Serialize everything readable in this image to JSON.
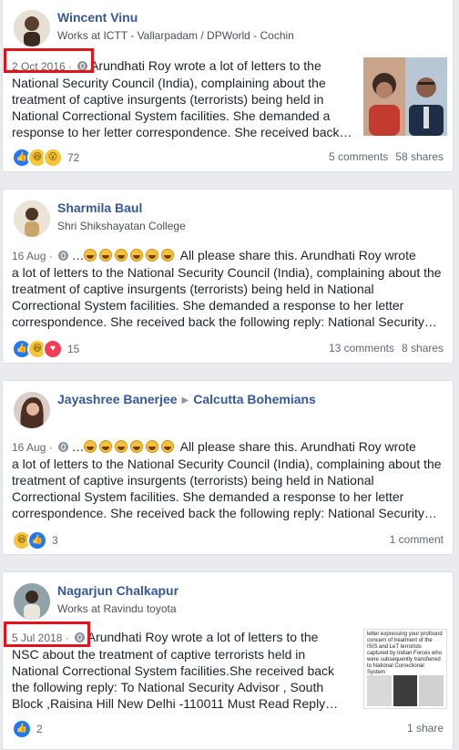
{
  "posts": [
    {
      "name": "Wincent Vinu",
      "subtitle": "Works at ICTT - Vallarpadam / DPWorld - Cochin",
      "time": "2 Oct 2016 ·",
      "lines": [
        "Arundhati Roy wrote a lot of letters to the",
        "National Security Council (India), complaining about the",
        "treatment of captive insurgents (terrorists) being held in",
        "National Correctional System facilities. She demanded a",
        "response to her letter correspondence. She received back…"
      ],
      "reaction_count": "72",
      "comments": "5 comments",
      "shares": "58 shares"
    },
    {
      "name": "Sharmila Baul",
      "subtitle": "Shri Shikshayatan College",
      "time": "16 Aug ·",
      "dots": "…",
      "lines": [
        "All please share this. Arundhati Roy wrote",
        "a lot of letters to the National Security Council (India), complaining about the",
        "treatment of captive insurgents (terrorists) being held in National",
        "Correctional System facilities. She demanded a response to her letter",
        "correspondence. She received back the following reply: National Security…"
      ],
      "reaction_count": "15",
      "comments": "13 comments",
      "shares": "8 shares"
    },
    {
      "name": "Jayashree Banerjee",
      "group": "Calcutta Bohemians",
      "time": "16 Aug ·",
      "dots": "…",
      "lines": [
        "All please share this. Arundhati Roy wrote",
        "a lot of letters to the National Security Council (India), complaining about the",
        "treatment of captive insurgents (terrorists) being held in National",
        "Correctional System facilities. She demanded a response to her letter",
        "correspondence. She received back the following reply: National Security…"
      ],
      "reaction_count": "3",
      "comments": "1 comment"
    },
    {
      "name": "Nagarjun Chalkapur",
      "subtitle": "Works at Ravindu toyota",
      "time": "5 Jul 2018 ·",
      "lines": [
        "Arundhati Roy wrote a lot of letters to the",
        "NSC about the treatment of captive terrorists held in",
        "National Correctional System facilities.She received back",
        "the following reply: To National Security Advisor , South",
        "Block ,Raisina Hill New Delhi -110011 Must Read Reply…"
      ],
      "thumb_text": "letter expressing your profound concern of treatment of the ISIS and LeT terrorists captured by Indian Forces who were subsequently transferred to National Correctional System",
      "reaction_count": "2",
      "shares": "1 share"
    }
  ]
}
